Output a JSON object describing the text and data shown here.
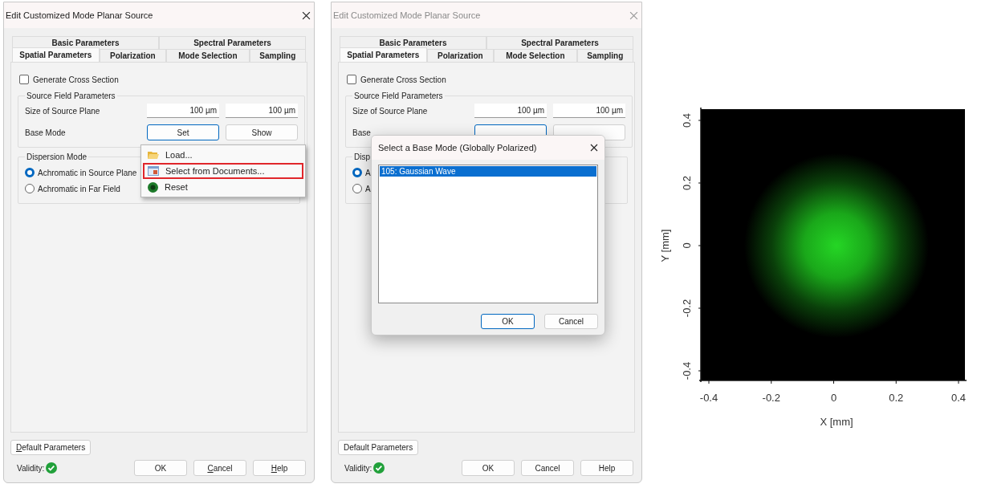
{
  "dialogs": [
    {
      "title": "Edit Customized Mode Planar Source",
      "active": true,
      "tab_rows": [
        {
          "tabs": [
            {
              "label": "Basic Parameters",
              "selected": false
            },
            {
              "label": "Spectral Parameters",
              "selected": false
            }
          ]
        },
        {
          "tabs": [
            {
              "label": "Spatial Parameters",
              "selected": true
            },
            {
              "label": "Polarization",
              "selected": false
            },
            {
              "label": "Mode Selection",
              "selected": false
            },
            {
              "label": "Sampling",
              "selected": false
            }
          ]
        }
      ],
      "cross_section": {
        "label": "Generate Cross Section",
        "checked": false
      },
      "source_group": {
        "legend": "Source Field Parameters",
        "size_label": "Size of Source Plane",
        "size_values": [
          "100 µm",
          "100 µm"
        ],
        "base_label": "Base Mode",
        "base_buttons": [
          {
            "label": "Set",
            "focused": true
          },
          {
            "label": "Show",
            "focused": false
          }
        ]
      },
      "dispersion": {
        "legend": "Dispersion Mode",
        "options": [
          {
            "label": "Achromatic in Source Plane",
            "selected": true
          },
          {
            "label": "Achromatic in Far Field",
            "selected": false
          }
        ]
      },
      "default_button": {
        "label": "Default Parameters",
        "access_key_shown": true
      },
      "validity": {
        "label": "Validity:",
        "valid": true
      },
      "buttons": [
        {
          "label": "OK",
          "access_key_shown": false
        },
        {
          "label": "Cancel",
          "access_key_shown": true
        },
        {
          "label": "Help",
          "access_key_shown": true
        }
      ],
      "menu": {
        "items": [
          {
            "label": "Load...",
            "kind": "load",
            "highlighted": false
          },
          {
            "label": "Select from Documents...",
            "kind": "documents",
            "highlighted": true
          },
          {
            "label": "Reset",
            "kind": "reset",
            "highlighted": false
          }
        ]
      }
    },
    {
      "title": "Edit Customized Mode Planar Source",
      "active": false,
      "tab_rows": [
        {
          "tabs": [
            {
              "label": "Basic Parameters",
              "selected": false
            },
            {
              "label": "Spectral Parameters",
              "selected": false
            }
          ]
        },
        {
          "tabs": [
            {
              "label": "Spatial Parameters",
              "selected": true
            },
            {
              "label": "Polarization",
              "selected": false
            },
            {
              "label": "Mode Selection",
              "selected": false
            },
            {
              "label": "Sampling",
              "selected": false
            }
          ]
        }
      ],
      "cross_section": {
        "label": "Generate Cross Section",
        "checked": false
      },
      "source_group": {
        "legend": "Source Field Parameters",
        "size_label": "Size of Source Plane",
        "size_values": [
          "100 µm",
          "100 µm"
        ],
        "base_label": "Base",
        "base_buttons": [
          {
            "focused": true
          },
          {
            "focused": false
          }
        ]
      },
      "dispersion": {
        "legend": "Disp",
        "options": [
          {
            "label": "A",
            "selected": true
          },
          {
            "label": "A",
            "selected": false
          }
        ]
      },
      "default_button": {
        "label": "Default Parameters",
        "access_key_shown": false
      },
      "validity": {
        "label": "Validity:",
        "valid": true
      },
      "buttons": [
        {
          "label": "OK",
          "access_key_shown": false
        },
        {
          "label": "Cancel",
          "access_key_shown": false
        },
        {
          "label": "Help",
          "access_key_shown": false
        }
      ],
      "popup": {
        "title": "Select a Base Mode (Globally Polarized)",
        "items": [
          {
            "label": "105: Gaussian Wave",
            "selected": true
          }
        ],
        "buttons": [
          {
            "label": "OK",
            "focused": true
          },
          {
            "label": "Cancel",
            "focused": false
          }
        ]
      }
    }
  ],
  "plot": {
    "xlabel": "X [mm]",
    "ylabel": "Y [mm]",
    "xticks": [
      "-0.4",
      "-0.2",
      "0",
      "0.2",
      "0.4"
    ],
    "yticks": [
      "0.4",
      "0.2",
      "0",
      "-0.2",
      "-0.4"
    ]
  }
}
